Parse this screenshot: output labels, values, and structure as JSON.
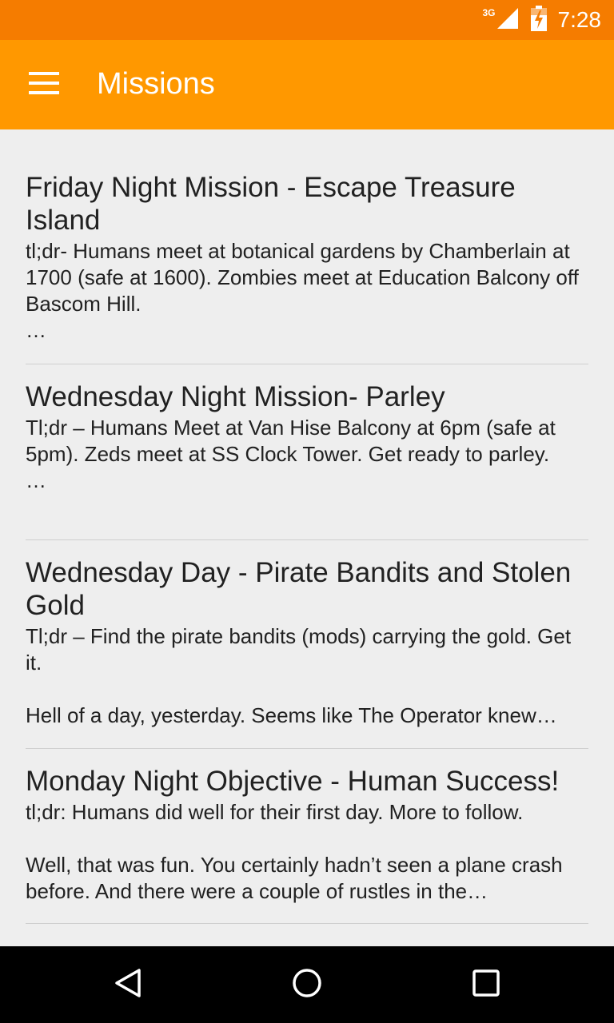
{
  "status_bar": {
    "network": "3G",
    "time": "7:28",
    "icons": [
      "signal-icon",
      "battery-icon"
    ]
  },
  "app_bar": {
    "title": "Missions",
    "menu_icon": "menu-icon"
  },
  "posts": [
    {
      "title": "Friday Night Mission - Escape Treasure Island",
      "excerpt": "tl;dr- Humans meet at botanical gardens by Chamberlain at 1700 (safe at 1600). Zombies meet at Education Balcony off Bascom Hill.\n …"
    },
    {
      "title": "Wednesday Night Mission- Parley",
      "excerpt": "Tl;dr – Humans Meet at Van Hise Balcony at 6pm (safe at 5pm). Zeds meet at SS Clock Tower. Get ready to parley.\n …"
    },
    {
      "title": "Wednesday Day - Pirate Bandits and Stolen Gold",
      "excerpt": "Tl;dr – Find the pirate bandits (mods) carrying the gold. Get it.\n\nHell of a day, yesterday. Seems like The Operator knew…"
    },
    {
      "title": "Monday Night Objective - Human Success!",
      "excerpt": "tl;dr:  Humans did well for their first day.  More to follow.\n\nWell, that was fun. You certainly hadn’t seen a plane crash before. And there were a couple of rustles in the…"
    }
  ],
  "nav_bar": {
    "icons": [
      "back-icon",
      "home-icon",
      "recents-icon"
    ]
  },
  "colors": {
    "status_bar": "#f57c00",
    "app_bar": "#ff9800",
    "background": "#eeeeee",
    "text": "#212121",
    "divider": "#cfcfcf",
    "nav_bar": "#000000"
  }
}
